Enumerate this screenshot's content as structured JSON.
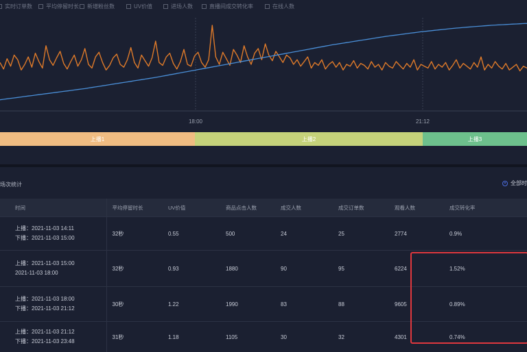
{
  "legend": {
    "items": [
      {
        "label": "实时订单数"
      },
      {
        "label": "平均停留时长"
      },
      {
        "label": "新增粉丝数"
      },
      {
        "label": "UV价值"
      },
      {
        "label": "进场人数"
      },
      {
        "label": "直播间成交转化率"
      },
      {
        "label": "在线人数"
      }
    ]
  },
  "chart_data": {
    "type": "line",
    "title": "",
    "xlabel": "",
    "ylabel": "",
    "x_ticks": [
      "18:00",
      "21:12"
    ],
    "grid": false,
    "series": [
      {
        "color": "#e07b2a",
        "values": [
          52,
          45,
          56,
          48,
          60,
          55,
          44,
          50,
          58,
          47,
          62,
          53,
          46,
          70,
          55,
          49,
          57,
          64,
          51,
          45,
          53,
          60,
          48,
          55,
          67,
          50,
          46,
          58,
          63,
          52,
          44,
          49,
          57,
          61,
          50,
          47,
          55,
          68,
          52,
          46,
          60,
          54,
          48,
          57,
          75,
          52,
          49,
          58,
          62,
          51,
          45,
          53,
          66,
          50,
          48,
          59,
          63,
          52,
          47,
          55,
          92,
          58,
          50,
          63,
          56,
          49,
          66,
          60,
          52,
          70,
          58,
          50,
          62,
          67,
          55,
          72,
          60,
          54,
          64,
          58,
          52,
          60,
          57,
          50,
          55,
          48,
          53,
          58,
          46,
          52,
          49,
          55,
          45,
          50,
          53,
          47,
          52,
          44,
          50,
          48,
          54,
          46,
          51,
          49,
          45,
          53,
          47,
          50,
          44,
          52,
          48,
          46,
          53,
          49,
          45,
          51,
          47,
          55,
          44,
          50,
          48,
          46,
          53,
          45,
          50,
          47,
          52,
          44,
          49,
          55,
          46,
          51,
          48,
          45,
          52,
          47,
          58,
          44,
          50,
          46,
          53,
          48,
          45,
          51,
          44,
          47,
          50,
          43,
          48,
          46
        ]
      },
      {
        "color": "#4a8fd8",
        "values": [
          12,
          12.5,
          13,
          13.5,
          14,
          14.5,
          15,
          15.5,
          16,
          16.5,
          17,
          17.5,
          18,
          18.5,
          19,
          19.5,
          20,
          20.5,
          21,
          21.5,
          22,
          22.5,
          23,
          23.5,
          24,
          24.6,
          25.2,
          25.8,
          26.4,
          27,
          27.6,
          28.2,
          28.8,
          29.4,
          30,
          30.6,
          31.2,
          31.8,
          32.4,
          33,
          33.6,
          34.2,
          34.8,
          35.4,
          36,
          36.7,
          37.4,
          38.1,
          38.8,
          39.5,
          40.2,
          40.9,
          41.6,
          42.3,
          43,
          43.7,
          44.4,
          45.1,
          45.8,
          46.5,
          47.2,
          47.9,
          48.6,
          49.3,
          50,
          50.7,
          51.4,
          52.1,
          52.8,
          53.5,
          54.2,
          54.9,
          55.6,
          56.3,
          57,
          57.7,
          58.4,
          59.1,
          59.8,
          60.5,
          61.2,
          61.9,
          62.6,
          63.3,
          64,
          64.7,
          65.4,
          66.1,
          66.8,
          67.5,
          68.2,
          68.9,
          69.6,
          70.3,
          71,
          71.6,
          72.2,
          72.8,
          73.4,
          74,
          74.6,
          75.2,
          75.8,
          76.4,
          77,
          77.6,
          78.2,
          78.8,
          79.4,
          80,
          80.5,
          81,
          81.5,
          82,
          82.5,
          83,
          83.5,
          84,
          84.5,
          85,
          85.4,
          85.8,
          86.2,
          86.6,
          87,
          87.4,
          87.8,
          88.2,
          88.6,
          89,
          89.3,
          89.6,
          89.9,
          90.2,
          90.5,
          90.8,
          91.1,
          91.4,
          91.7,
          92,
          92.2,
          92.4,
          92.6,
          92.8,
          93,
          93.2,
          93.4,
          93.6,
          93.8,
          94
        ]
      }
    ]
  },
  "timeline": {
    "segments": [
      {
        "label": "上播1",
        "color": "#f0bc82"
      },
      {
        "label": "上播2",
        "color": "#c5d27a"
      },
      {
        "label": "上播3",
        "color": "#6dc08c"
      }
    ]
  },
  "section": {
    "title": "场次统计",
    "toggle_label": "全部时"
  },
  "table": {
    "headers": [
      "时间",
      "平均停留时长",
      "UV价值",
      "商品点击人数",
      "成交人数",
      "成交订单数",
      "观看人数",
      "成交转化率"
    ],
    "rows": [
      {
        "time1": "上播：2021-11-03 14:11",
        "time2": "下播：2021-11-03 15:00",
        "cells": [
          "32秒",
          "0.55",
          "500",
          "24",
          "25",
          "2774",
          "0.9%"
        ]
      },
      {
        "time1": "上播：2021-11-03 15:00",
        "time2": "2021-11-03 18:00",
        "cells": [
          "32秒",
          "0.93",
          "1880",
          "90",
          "95",
          "6224",
          "1.52%"
        ]
      },
      {
        "time1": "上播：2021-11-03 18:00",
        "time2": "下播：2021-11-03 21:12",
        "cells": [
          "30秒",
          "1.22",
          "1990",
          "83",
          "88",
          "9605",
          "0.89%"
        ]
      },
      {
        "time1": "上播：2021-11-03 21:12",
        "time2": "下播：2021-11-03 23:48",
        "cells": [
          "31秒",
          "1.18",
          "1105",
          "30",
          "32",
          "4301",
          "0.74%"
        ]
      }
    ]
  }
}
